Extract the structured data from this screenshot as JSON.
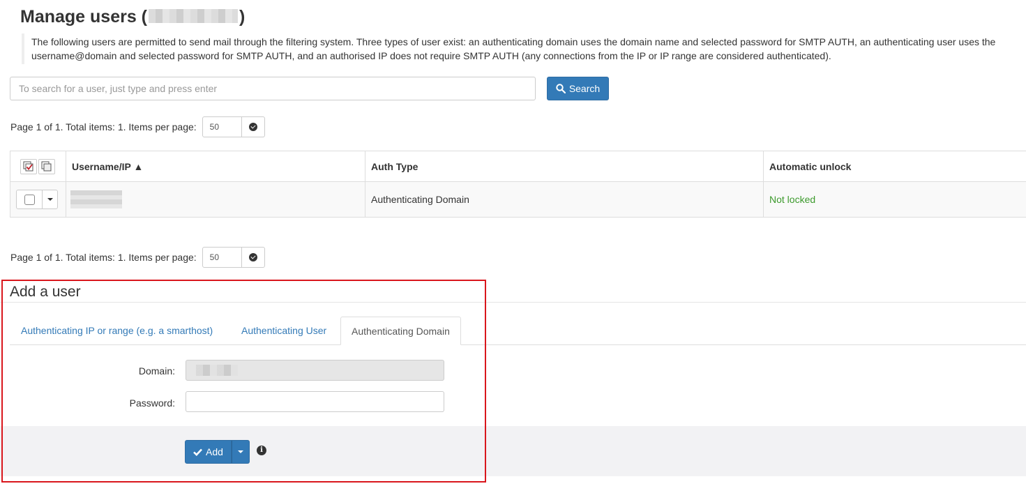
{
  "page": {
    "title_prefix": "Manage users (",
    "title_suffix": ")",
    "description": "The following users are permitted to send mail through the filtering system. Three types of user exist: an authenticating domain uses the domain name and selected password for SMTP AUTH, an authenticating user uses the username@domain and selected password for SMTP AUTH, and an authorised IP does not require SMTP AUTH (any connections from the IP or IP range are considered authenticated)."
  },
  "search": {
    "placeholder": "To search for a user, just type and press enter",
    "button_label": "Search",
    "icon": "search-icon"
  },
  "pagination": {
    "text": "Page 1 of 1. Total items: 1. Items per page:",
    "items_per_page": "50"
  },
  "table": {
    "columns": [
      "Username/IP ▲",
      "Auth Type",
      "Automatic unlock"
    ],
    "rows": [
      {
        "username": "",
        "auth_type": "Authenticating Domain",
        "unlock": "Not locked"
      }
    ],
    "status_color": "#3c9a2c"
  },
  "add_user": {
    "title": "Add a user",
    "tabs": [
      {
        "label": "Authenticating IP or range (e.g. a smarthost)",
        "active": false
      },
      {
        "label": "Authenticating User",
        "active": false
      },
      {
        "label": "Authenticating Domain",
        "active": true
      }
    ],
    "domain_label": "Domain:",
    "password_label": "Password:",
    "add_label": "Add"
  },
  "colors": {
    "primary": "#337ab7",
    "highlight_border": "#d9161c"
  }
}
